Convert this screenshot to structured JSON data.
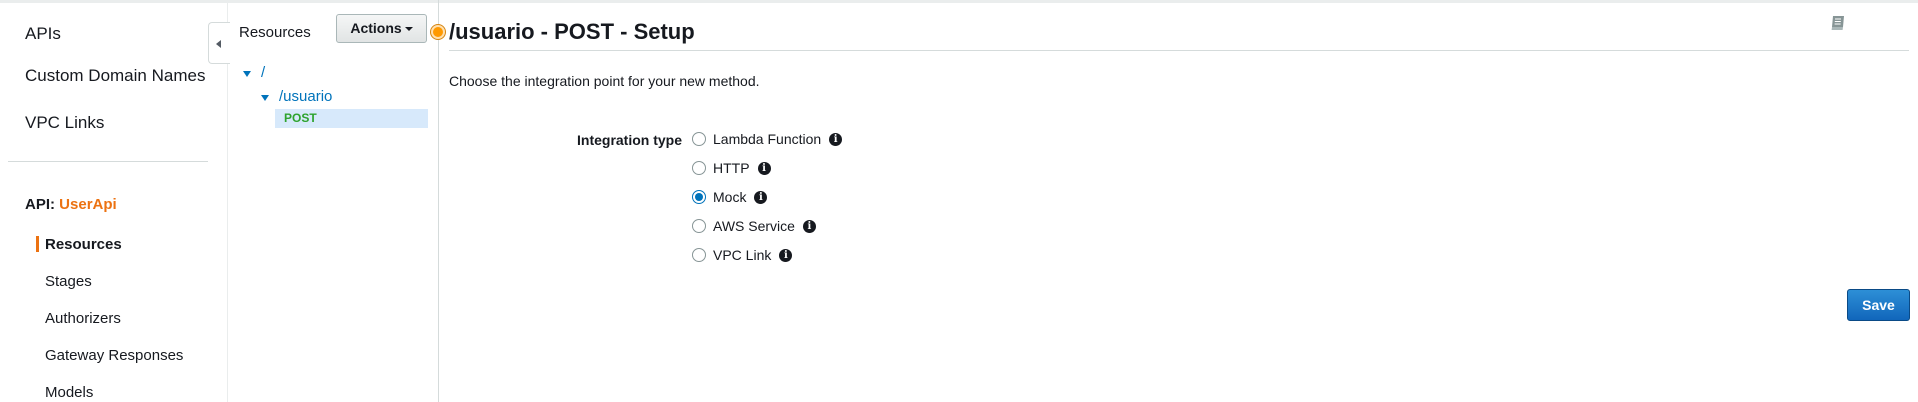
{
  "nav": {
    "top_items": [
      "APIs",
      "Custom Domain Names",
      "VPC Links"
    ],
    "api_prefix": "API:",
    "api_name": "UserApi",
    "sub_items": [
      "Resources",
      "Stages",
      "Authorizers",
      "Gateway Responses",
      "Models"
    ]
  },
  "tree": {
    "title": "Resources",
    "actions_label": "Actions",
    "root": "/",
    "resource": "/usuario",
    "method": "POST"
  },
  "main": {
    "title": "/usuario - POST - Setup",
    "intro": "Choose the integration point for your new method.",
    "field_label": "Integration type",
    "options": [
      "Lambda Function",
      "HTTP",
      "Mock",
      "AWS Service",
      "VPC Link"
    ],
    "selected": "Mock",
    "save_label": "Save"
  },
  "colors": {
    "accent_orange": "#ec7211",
    "link_blue": "#0073bb",
    "post_green": "#2ea32e",
    "selected_row": "#d7e9fb"
  },
  "icons": {
    "info": "info-icon",
    "docs": "book-icon",
    "collapse": "chevron-left-icon"
  }
}
